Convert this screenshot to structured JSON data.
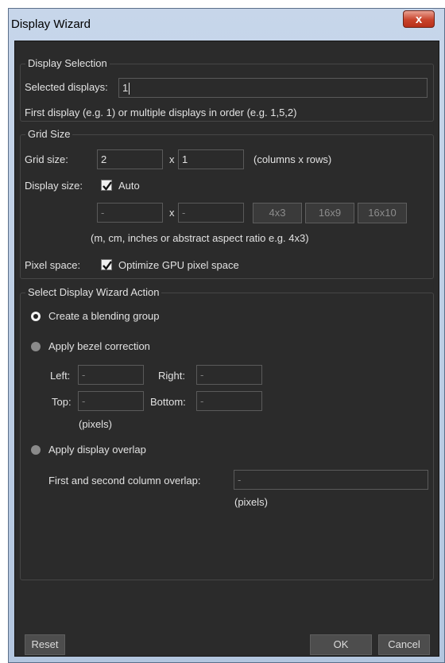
{
  "window": {
    "title": "Display Wizard",
    "close_glyph": "x"
  },
  "display_selection": {
    "legend": "Display Selection",
    "selected_label": "Selected displays:",
    "selected_value": "1",
    "hint": "First display (e.g. 1) or multiple displays in order (e.g. 1,5,2)"
  },
  "grid_size": {
    "legend": "Grid Size",
    "grid_label": "Grid size:",
    "columns": "2",
    "x": "x",
    "rows": "1",
    "grid_unit": "(columns x rows)",
    "display_size_label": "Display size:",
    "auto_label": "Auto",
    "auto_checked": true,
    "width_value": "-",
    "height_value": "-",
    "aspect_buttons": [
      "4x3",
      "16x9",
      "16x10"
    ],
    "size_hint": "(m, cm, inches or abstract aspect ratio e.g. 4x3)",
    "pixel_space_label": "Pixel space:",
    "optimize_label": "Optimize GPU pixel space",
    "optimize_checked": true
  },
  "action": {
    "legend": "Select Display Wizard Action",
    "opt_blending": "Create a blending group",
    "opt_bezel": "Apply bezel correction",
    "left_label": "Left:",
    "left_value": "-",
    "right_label": "Right:",
    "right_value": "-",
    "top_label": "Top:",
    "top_value": "-",
    "bottom_label": "Bottom:",
    "bottom_value": "-",
    "bezel_unit": "(pixels)",
    "opt_overlap": "Apply display overlap",
    "overlap_label": "First and second column overlap:",
    "overlap_value": "-",
    "overlap_unit": "(pixels)",
    "selected": "blending"
  },
  "footer": {
    "reset": "Reset",
    "ok": "OK",
    "cancel": "Cancel"
  }
}
